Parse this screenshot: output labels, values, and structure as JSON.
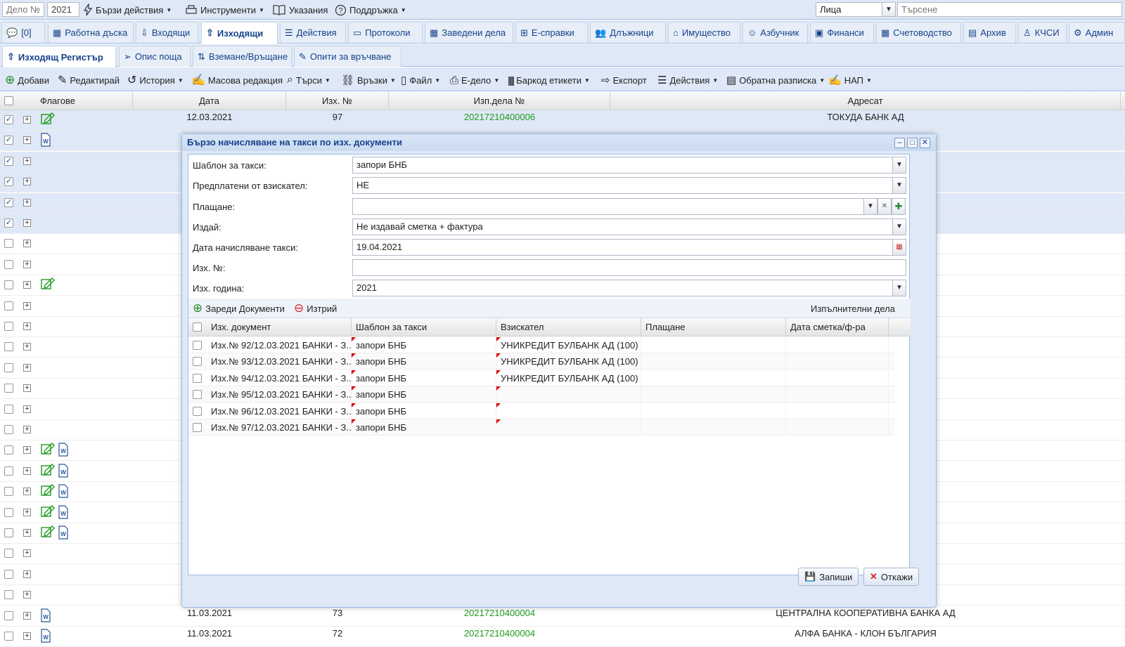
{
  "topbar": {
    "case_no_placeholder": "Дело №",
    "year_value": "2021",
    "quick_actions": "Бързи действия",
    "tools": "Инструменти",
    "instructions": "Указания",
    "support": "Поддръжка",
    "persons_value": "Лица",
    "search_placeholder": "Търсене"
  },
  "tabs": [
    {
      "label": "[0]"
    },
    {
      "label": "Работна дъска"
    },
    {
      "label": "Входящи"
    },
    {
      "label": "Изходящи"
    },
    {
      "label": "Действия"
    },
    {
      "label": "Протоколи"
    },
    {
      "label": "Заведени дела"
    },
    {
      "label": "Е-справки"
    },
    {
      "label": "Длъжници"
    },
    {
      "label": "Имущество"
    },
    {
      "label": "Азбучник"
    },
    {
      "label": "Финанси"
    },
    {
      "label": "Счетоводство"
    },
    {
      "label": "Архив"
    },
    {
      "label": "КЧСИ"
    },
    {
      "label": "Админ"
    }
  ],
  "subtabs": [
    {
      "label": "Изходящ Регистър"
    },
    {
      "label": "Опис поща"
    },
    {
      "label": "Вземане/Връщане"
    },
    {
      "label": "Опити за връчване"
    }
  ],
  "toolbar": {
    "add": "Добави",
    "edit": "Редактирай",
    "history": "История",
    "mass_edit": "Масова редакция",
    "search": "Търси",
    "links": "Връзки",
    "file": "Файл",
    "ecase": "Е-дело",
    "barcode": "Баркод етикети",
    "export": "Експорт",
    "actions": "Действия",
    "receipt": "Обратна разписка",
    "nra": "НАП"
  },
  "grid": {
    "columns": {
      "flags": "Флагове",
      "date": "Дата",
      "out_no": "Изх. №",
      "case_no": "Изп.дела №",
      "addressee": "Адресат"
    },
    "rows": [
      {
        "checked": true,
        "flags": [
          "edit"
        ],
        "date": "12.03.2021",
        "out_no": "97",
        "case_no": "20217210400006",
        "addressee": "ТОКУДА БАНК АД"
      },
      {
        "checked": true,
        "flags": [
          "word"
        ],
        "date": "",
        "out_no": "",
        "case_no": "",
        "addressee": ""
      },
      {
        "checked": true,
        "flags": [],
        "date": "",
        "out_no": "",
        "case_no": "",
        "addressee": ""
      },
      {
        "checked": true,
        "flags": [],
        "date": "",
        "out_no": "",
        "case_no": "",
        "addressee": ""
      },
      {
        "checked": true,
        "flags": [],
        "date": "",
        "out_no": "",
        "case_no": "",
        "addressee": ""
      },
      {
        "checked": true,
        "flags": [],
        "date": "",
        "out_no": "",
        "case_no": "",
        "addressee": ""
      },
      {
        "checked": false,
        "flags": [],
        "date": "",
        "out_no": "",
        "case_no": "",
        "addressee": ""
      },
      {
        "checked": false,
        "flags": [],
        "date": "",
        "out_no": "",
        "case_no": "",
        "addressee": ""
      },
      {
        "checked": false,
        "flags": [
          "edit"
        ],
        "date": "",
        "out_no": "",
        "case_no": "",
        "addressee": ""
      },
      {
        "checked": false,
        "flags": [],
        "date": "",
        "out_no": "",
        "case_no": "",
        "addressee": ""
      },
      {
        "checked": false,
        "flags": [],
        "date": "",
        "out_no": "",
        "case_no": "",
        "addressee": ""
      },
      {
        "checked": false,
        "flags": [],
        "date": "",
        "out_no": "",
        "case_no": "",
        "addressee": ""
      },
      {
        "checked": false,
        "flags": [],
        "date": "",
        "out_no": "",
        "case_no": "",
        "addressee": ""
      },
      {
        "checked": false,
        "flags": [],
        "date": "",
        "out_no": "",
        "case_no": "",
        "addressee": ""
      },
      {
        "checked": false,
        "flags": [],
        "date": "",
        "out_no": "",
        "case_no": "",
        "addressee": ""
      },
      {
        "checked": false,
        "flags": [],
        "date": "",
        "out_no": "",
        "case_no": "",
        "addressee": ""
      },
      {
        "checked": false,
        "flags": [
          "edit",
          "word"
        ],
        "date": "",
        "out_no": "",
        "case_no": "",
        "addressee": ""
      },
      {
        "checked": false,
        "flags": [
          "edit",
          "word"
        ],
        "date": "",
        "out_no": "",
        "case_no": "",
        "addressee": ""
      },
      {
        "checked": false,
        "flags": [
          "edit",
          "word"
        ],
        "date": "",
        "out_no": "",
        "case_no": "",
        "addressee": ""
      },
      {
        "checked": false,
        "flags": [
          "edit",
          "word"
        ],
        "date": "",
        "out_no": "",
        "case_no": "",
        "addressee": ""
      },
      {
        "checked": false,
        "flags": [
          "edit",
          "word"
        ],
        "date": "",
        "out_no": "",
        "case_no": "",
        "addressee": ""
      },
      {
        "checked": false,
        "flags": [],
        "date": "",
        "out_no": "",
        "case_no": "",
        "addressee": ""
      },
      {
        "checked": false,
        "flags": [],
        "date": "",
        "out_no": "",
        "case_no": "",
        "addressee": ""
      },
      {
        "checked": false,
        "flags": [],
        "date": "",
        "out_no": "",
        "case_no": "",
        "addressee": ""
      },
      {
        "checked": false,
        "flags": [
          "word"
        ],
        "date": "11.03.2021",
        "out_no": "73",
        "case_no": "20217210400004",
        "addressee": "ЦЕНТРАЛНА КООПЕРАТИВНА БАНКА АД"
      },
      {
        "checked": false,
        "flags": [
          "word"
        ],
        "date": "11.03.2021",
        "out_no": "72",
        "case_no": "20217210400004",
        "addressee": "АЛФА БАНКА - КЛОН БЪЛГАРИЯ"
      }
    ]
  },
  "dialog": {
    "title": "Бързо начисляване на такси по изх. документи",
    "fields": {
      "template_label": "Шаблон за такси:",
      "template_value": "запори БНБ",
      "prepaid_label": "Предплатени от взискател:",
      "prepaid_value": "НЕ",
      "payment_label": "Плащане:",
      "payment_value": "",
      "issue_label": "Издай:",
      "issue_value": "Не издавай сметка + фактура",
      "date_label": "Дата начисляване такси:",
      "date_value": "19.04.2021",
      "outno_label": "Изх. №:",
      "outno_value": "",
      "outyear_label": "Изх. година:",
      "outyear_value": "2021"
    },
    "load_docs": "Зареди Документи",
    "delete": "Изтрий",
    "exec_cases": "Изпълнителни дела",
    "columns": {
      "doc": "Изх. документ",
      "template": "Шаблон за такси",
      "creditor": "Взискател",
      "payment": "Плащане",
      "invoice_date": "Дата сметка/ф-ра"
    },
    "rows": [
      {
        "doc": "Изх.№ 92/12.03.2021 БАНКИ - З...",
        "template": "запори БНБ",
        "creditor": "УНИКРЕДИТ БУЛБАНК АД (100)"
      },
      {
        "doc": "Изх.№ 93/12.03.2021 БАНКИ - З...",
        "template": "запори БНБ",
        "creditor": "УНИКРЕДИТ БУЛБАНК АД (100)"
      },
      {
        "doc": "Изх.№ 94/12.03.2021 БАНКИ - З...",
        "template": "запори БНБ",
        "creditor": "УНИКРЕДИТ БУЛБАНК АД (100)"
      },
      {
        "doc": "Изх.№ 95/12.03.2021 БАНКИ - З...",
        "template": "запори БНБ",
        "creditor": ""
      },
      {
        "doc": "Изх.№ 96/12.03.2021 БАНКИ - З...",
        "template": "запори БНБ",
        "creditor": ""
      },
      {
        "doc": "Изх.№ 97/12.03.2021 БАНКИ - З...",
        "template": "запори БНБ",
        "creditor": ""
      }
    ],
    "save": "Запиши",
    "cancel": "Откажи"
  },
  "colors": {
    "accent": "#15428b",
    "panel": "#dfe8f6",
    "green": "#1e9a1e"
  }
}
